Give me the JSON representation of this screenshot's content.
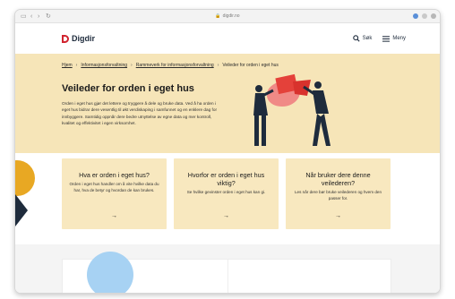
{
  "browser": {
    "url": "digdir.no"
  },
  "header": {
    "logo_text": "Digdir",
    "search_label": "Søk",
    "menu_label": "Meny"
  },
  "breadcrumb": [
    "Hjem",
    "Informasjonsforvaltning",
    "Rammeverk for informasjonsforvaltning",
    "Veileder for orden i eget hus"
  ],
  "hero": {
    "title": "Veileder for orden i eget hus",
    "text": "Orden i eget hus gjør det lettere og tryggere å dele og bruke data. Ved å ha orden i eget hus bidrar dere vesentlig til økt verdiskaping i samfunnet og en enklere dag for innbyggere. Samtidig oppnår dere bedre utnyttelse av egne data og mer kontroll, kvalitet og effektivitet i egen virksomhet."
  },
  "cards": [
    {
      "title": "Hva er orden i eget hus?",
      "text": "Orden i eget hus handler om å vite hvilke data du har, hva de betyr og hvordan de kan brukes.",
      "arrow": "→"
    },
    {
      "title": "Hvorfor er orden i eget hus viktig?",
      "text": "Se hvilke gevinster orden i eget hus kan gi.",
      "arrow": "→"
    },
    {
      "title": "Når bruker dere denne veilederen?",
      "text": "Les når dere bør bruke veilederen og hvem den passer for.",
      "arrow": "→"
    }
  ],
  "colors": {
    "hero_bg": "#f6e5b8",
    "card_bg": "#f8e8bf",
    "brand_red": "#d1242f",
    "navy": "#1e2b3c",
    "accent_yellow": "#e8a823",
    "accent_blue": "#a7d2f3"
  },
  "icons": {
    "search": "search-icon",
    "menu": "menu-icon",
    "arrow": "arrow-right-icon"
  }
}
